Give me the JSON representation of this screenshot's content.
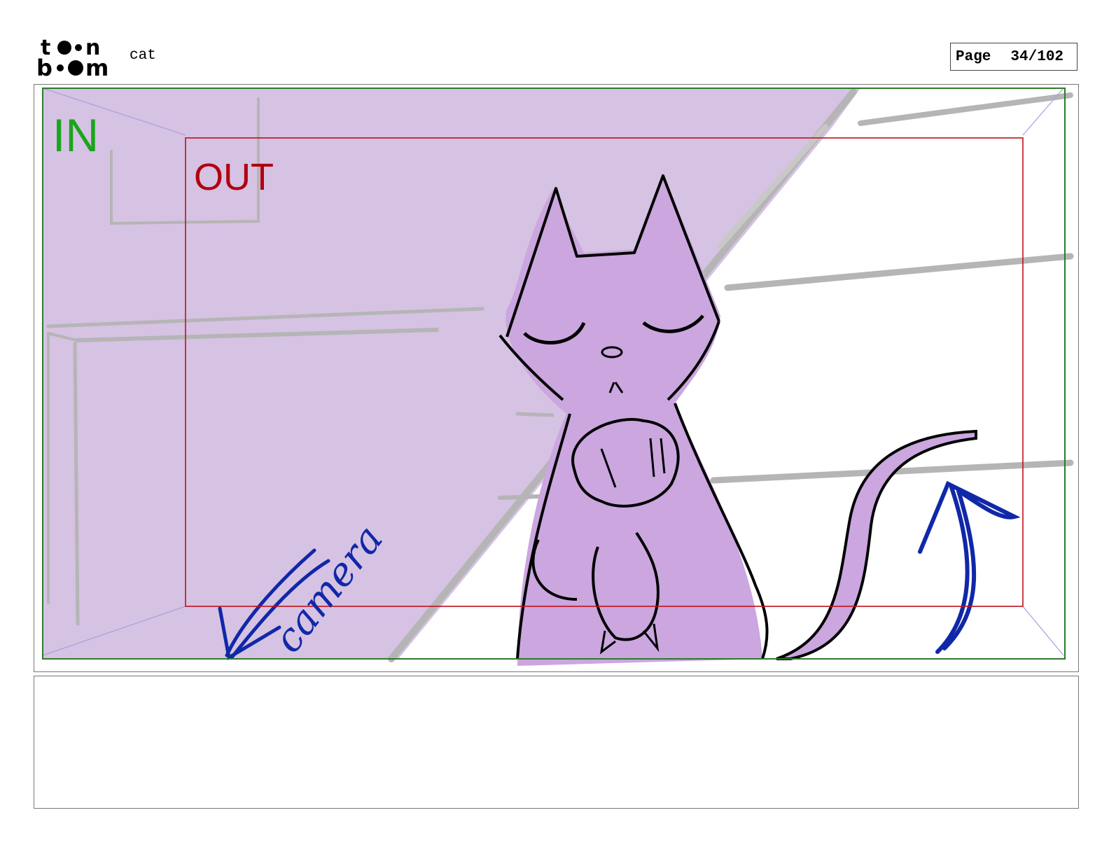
{
  "header": {
    "logo_text": "toon boom",
    "project_name": "cat",
    "page_label": "Page",
    "page_number": "34/102"
  },
  "panel": {
    "in_label": "IN",
    "out_label": "OUT",
    "annotation_text": "camera",
    "colors": {
      "in_frame": "#2d7a2d",
      "in_label": "#1aa51a",
      "out_frame": "#c0101a",
      "out_label": "#b00010",
      "background_wall": "#d6c2e3",
      "cat_fill": "#cba6df",
      "annotation_blue": "#1028a8",
      "set_lines": "#b5b5b5"
    }
  },
  "caption": {
    "dialogue": "",
    "notes": ""
  }
}
